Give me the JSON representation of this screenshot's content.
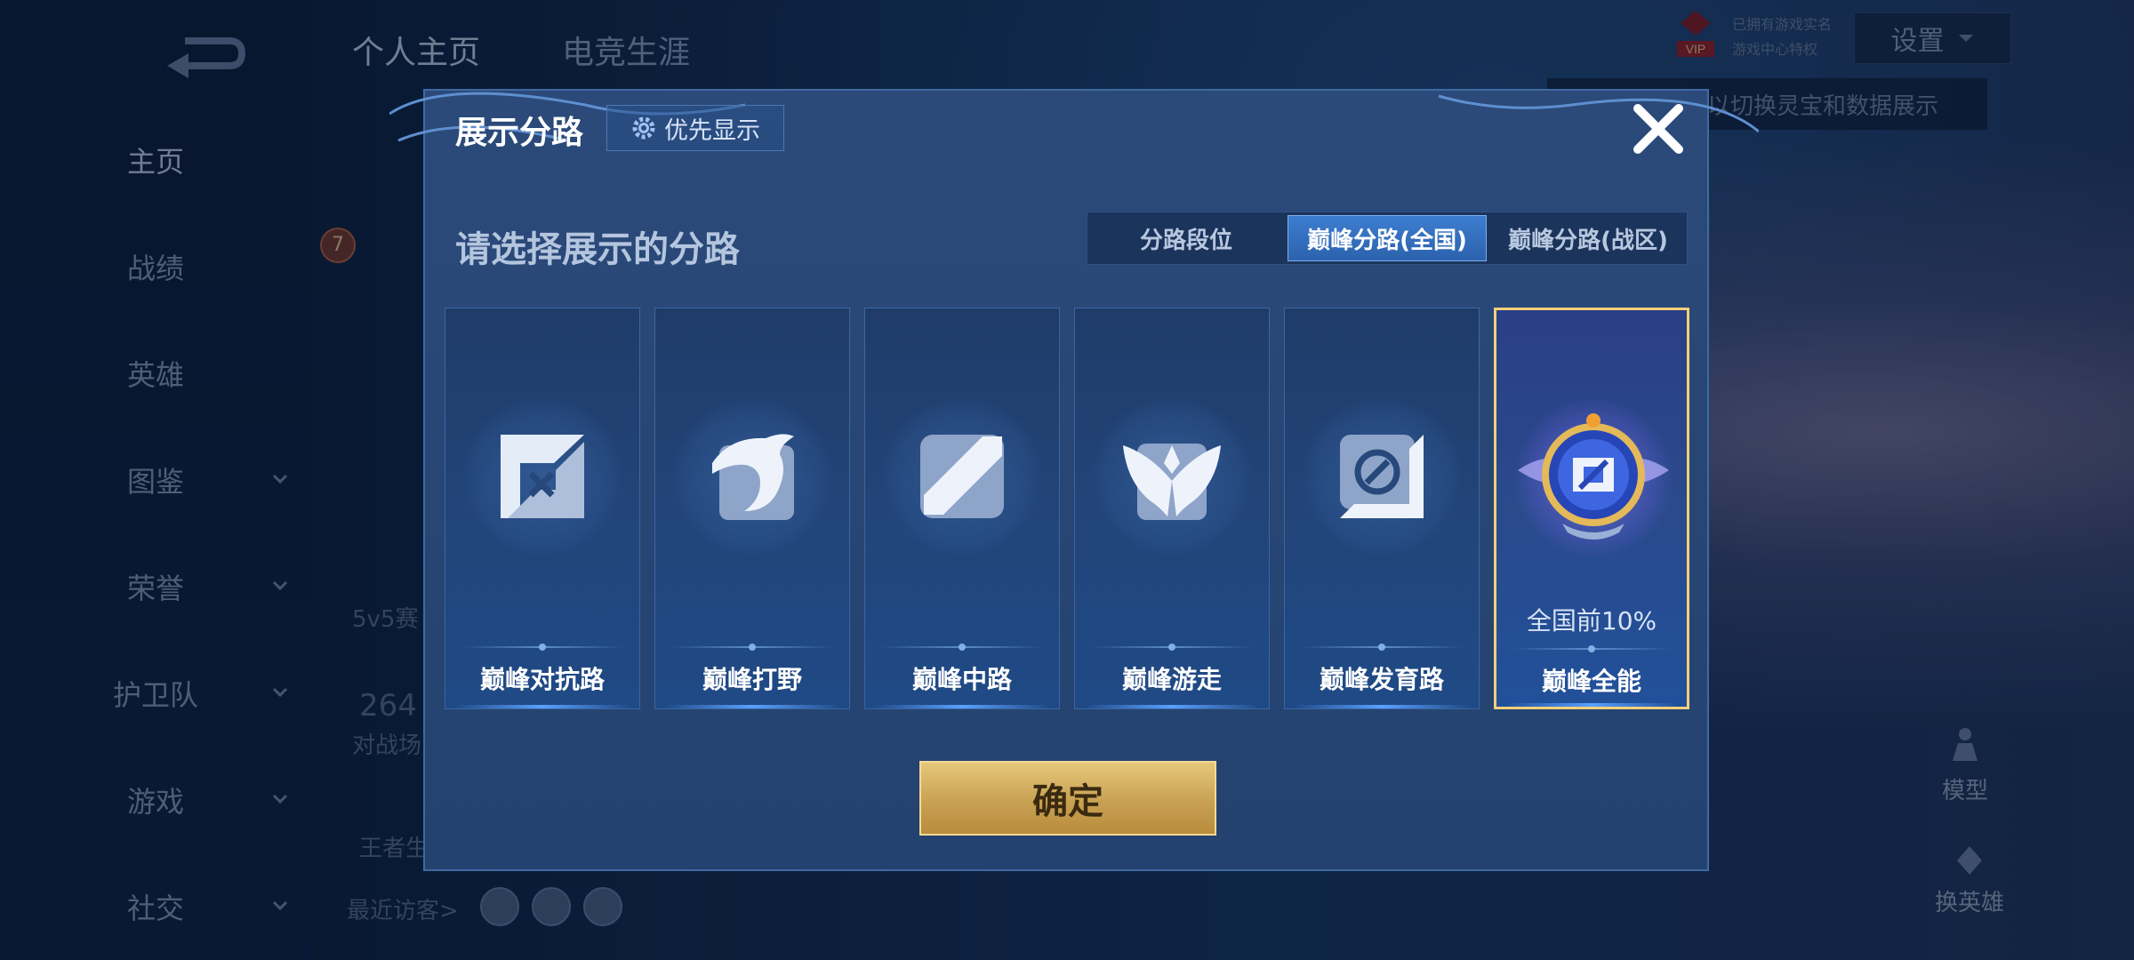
{
  "left_nav": {
    "items": [
      {
        "label": "主页",
        "chevron": false,
        "active": true
      },
      {
        "label": "战绩",
        "chevron": false
      },
      {
        "label": "英雄",
        "chevron": false
      },
      {
        "label": "图鉴",
        "chevron": true
      },
      {
        "label": "荣誉",
        "chevron": true
      },
      {
        "label": "护卫队",
        "chevron": true
      },
      {
        "label": "游戏",
        "chevron": true
      },
      {
        "label": "社交",
        "chevron": true
      }
    ]
  },
  "top_tabs": [
    {
      "label": "个人主页",
      "active": true
    },
    {
      "label": "电竞生涯",
      "active": false
    }
  ],
  "background": {
    "level_badge": "7",
    "mode_label": "5v5赛",
    "count_value": "264",
    "count_label": "对战场",
    "career_label": "王者生",
    "recent_visitors": "最近访客>",
    "hint": "以切换灵宝和数据展示",
    "vip_line1": "已拥有游戏实名",
    "vip_line2": "游戏中心特权",
    "vip_badge": "VIP",
    "model_label": "模型",
    "change_hero_label": "换英雄"
  },
  "settings": {
    "label": "设置"
  },
  "modal": {
    "title": "展示分路",
    "priority_label": "优先显示",
    "subtitle": "请选择展示的分路",
    "segments": [
      "分路段位",
      "巅峰分路(全国)",
      "巅峰分路(战区)"
    ],
    "active_segment": 1,
    "cards": [
      {
        "name": "巅峰对抗路",
        "icon": "crossed-swords-icon"
      },
      {
        "name": "巅峰打野",
        "icon": "dragon-icon"
      },
      {
        "name": "巅峰中路",
        "icon": "mid-lane-icon"
      },
      {
        "name": "巅峰游走",
        "icon": "wings-icon"
      },
      {
        "name": "巅峰发育路",
        "icon": "marksman-icon"
      },
      {
        "name": "巅峰全能",
        "icon": "all-round-emblem-icon",
        "rank": "全国前10%",
        "selected": true
      }
    ],
    "confirm_label": "确定"
  },
  "colors": {
    "accent": "#3d7dd0",
    "selected_border": "#f3cf7a",
    "confirm_gold": "#c9a153"
  }
}
